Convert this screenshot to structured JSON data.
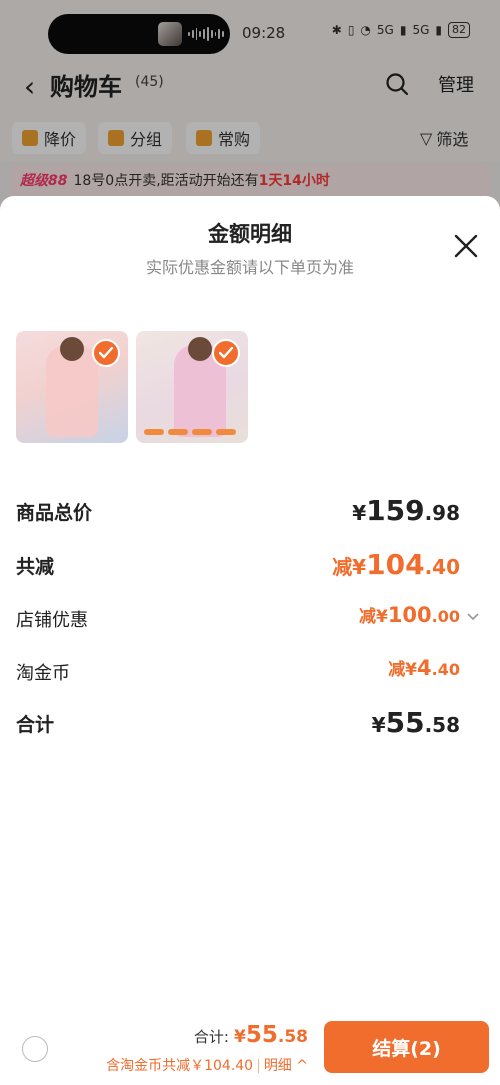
{
  "status_bar": {
    "time": "09:28",
    "battery": "82",
    "signal_1": "5G",
    "signal_2": "5G"
  },
  "header": {
    "back_icon": "chevron-left-icon",
    "title": "购物车",
    "count": "(45)",
    "search_icon": "search-icon",
    "manage": "管理"
  },
  "filters": {
    "items": [
      {
        "label": "降价",
        "icon": "price-down-icon"
      },
      {
        "label": "分组",
        "icon": "folder-icon"
      },
      {
        "label": "常购",
        "icon": "cart-icon"
      }
    ],
    "filter_label": "筛选"
  },
  "promo": {
    "logo": "超级88",
    "text": "18号0点开卖,距活动开始还有",
    "countdown": "1天14小时"
  },
  "sheet": {
    "title": "金额明细",
    "subtitle": "实际优惠金额请以下单页为准",
    "rows": [
      {
        "label": "商品总价",
        "prefix": "¥",
        "int": "159",
        "dec": ".98"
      },
      {
        "label": "共减",
        "prefix": "减¥",
        "int": "104",
        "dec": ".40"
      },
      {
        "label": "店铺优惠",
        "prefix": "减¥",
        "int": "100",
        "dec": ".00"
      },
      {
        "label": "淘金币",
        "prefix": "减¥",
        "int": "4",
        "dec": ".40"
      },
      {
        "label": "合计",
        "prefix": "¥",
        "int": "55",
        "dec": ".58"
      }
    ]
  },
  "bottom": {
    "total_label": "合计:",
    "currency": "¥",
    "total_int": "55",
    "total_dec": ".58",
    "discount_text": "含淘金币共减￥104.40",
    "detail_label": "明细",
    "checkout_label": "结算(2)"
  },
  "colors": {
    "accent": "#f06d2e",
    "promo_red": "#ff3b3b",
    "promo_bg": "#fdeceb"
  }
}
